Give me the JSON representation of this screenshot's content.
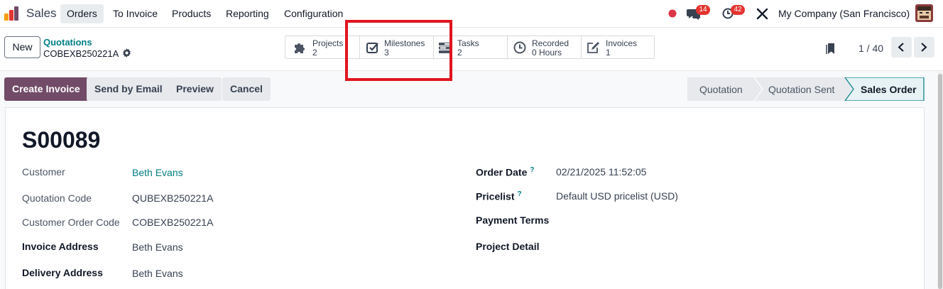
{
  "navbar": {
    "app_name": "Sales",
    "menu": [
      {
        "label": "Orders",
        "active": true
      },
      {
        "label": "To Invoice"
      },
      {
        "label": "Products"
      },
      {
        "label": "Reporting"
      },
      {
        "label": "Configuration"
      }
    ],
    "messages_count": "14",
    "activities_count": "42",
    "company": "My Company (San Francisco)",
    "status_dot_color": "#dc3545"
  },
  "breadcrumb": {
    "parent": "Quotations",
    "record": "COBEXB250221A"
  },
  "control": {
    "new_label": "New"
  },
  "smart_buttons": [
    {
      "label": "Projects",
      "value": "2",
      "icon": "puzzle-icon"
    },
    {
      "label": "Milestones",
      "value": "3",
      "icon": "check-square-icon"
    },
    {
      "label": "Tasks",
      "value": "2",
      "icon": "tasks-icon"
    },
    {
      "label": "Recorded",
      "value": "0 Hours",
      "icon": "clock-icon"
    },
    {
      "label": "Invoices",
      "value": "1",
      "icon": "pencil-square-icon"
    }
  ],
  "pager": {
    "text": "1 / 40"
  },
  "actions": {
    "create_invoice": "Create Invoice",
    "send_by_email": "Send by Email",
    "preview": "Preview",
    "cancel": "Cancel"
  },
  "stages": [
    {
      "label": "Quotation"
    },
    {
      "label": "Quotation Sent"
    },
    {
      "label": "Sales Order",
      "current": true
    }
  ],
  "form": {
    "name": "S00089",
    "left": [
      {
        "label": "Customer",
        "value": "Beth Evans"
      },
      {
        "label": "Quotation Code",
        "value": "QUBEXB250221A"
      },
      {
        "label": "Customer Order Code",
        "value": "COBEXB250221A"
      },
      {
        "label": "Invoice Address",
        "value": "Beth Evans"
      },
      {
        "label": "Delivery Address",
        "value": "Beth Evans"
      }
    ],
    "right": [
      {
        "label": "Order Date",
        "help": "?",
        "value": "02/21/2025 11:52:05"
      },
      {
        "label": "Pricelist",
        "help": "?",
        "value": "Default USD pricelist (USD)"
      },
      {
        "label": "Payment Terms",
        "value": ""
      },
      {
        "label": "Project Detail",
        "value": ""
      }
    ]
  },
  "colors": {
    "brand": "#714b67",
    "link": "#017e84",
    "highlight": "#e0141e"
  }
}
